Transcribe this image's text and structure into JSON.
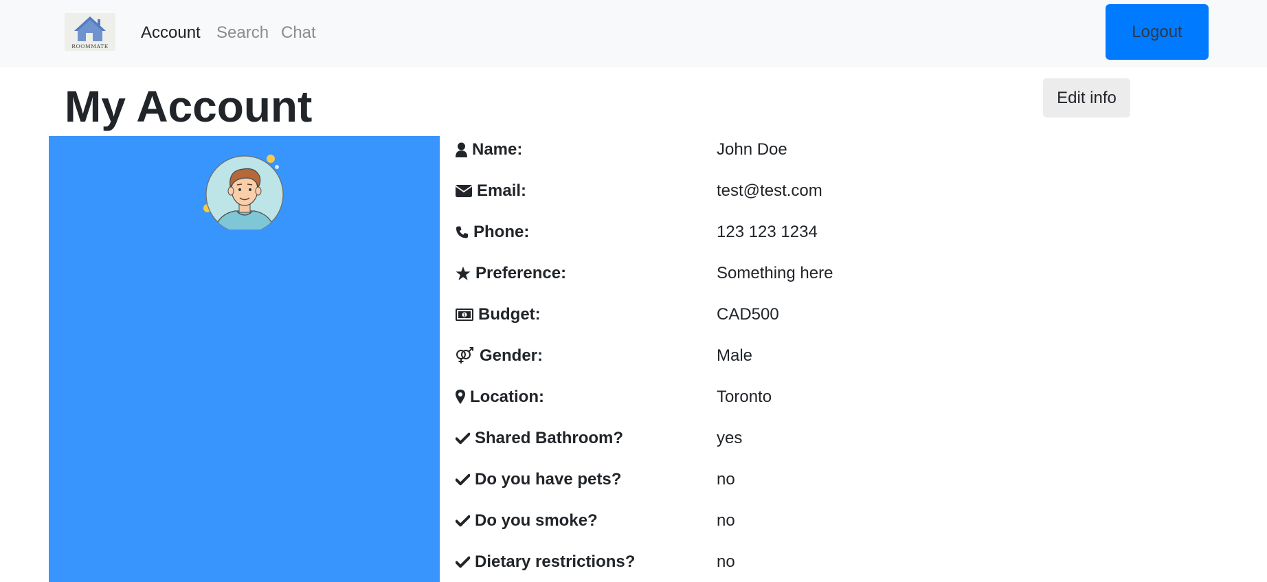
{
  "nav": {
    "logo_text": "ROOMMATE",
    "links": [
      "Account",
      "Search",
      "Chat"
    ],
    "logout_label": "Logout"
  },
  "header": {
    "title": "My Account",
    "edit_label": "Edit info"
  },
  "profile": {
    "panel_color": "#3895fd",
    "avatar_icon": "user-avatar-icon",
    "fields": [
      {
        "icon": "user-icon",
        "label": "Name:",
        "value": "John Doe"
      },
      {
        "icon": "envelope-icon",
        "label": "Email:",
        "value": "test@test.com"
      },
      {
        "icon": "phone-icon",
        "label": "Phone:",
        "value": "123 123 1234"
      },
      {
        "icon": "star-icon",
        "label": "Preference:",
        "value": "Something here"
      },
      {
        "icon": "money-bill-icon",
        "label": "Budget:",
        "value": "CAD500"
      },
      {
        "icon": "venus-mars-icon",
        "label": "Gender:",
        "value": "Male"
      },
      {
        "icon": "map-marker-icon",
        "label": "Location:",
        "value": "Toronto"
      },
      {
        "icon": "check-icon",
        "label": "Shared Bathroom?",
        "value": "yes"
      },
      {
        "icon": "check-icon",
        "label": "Do you have pets?",
        "value": "no"
      },
      {
        "icon": "check-icon",
        "label": "Do you smoke?",
        "value": "no"
      },
      {
        "icon": "check-icon",
        "label": "Dietary restrictions?",
        "value": "no"
      }
    ]
  },
  "colors": {
    "navbar_bg": "#f8f9fa",
    "primary": "#007bff",
    "panel": "#3895fd"
  }
}
